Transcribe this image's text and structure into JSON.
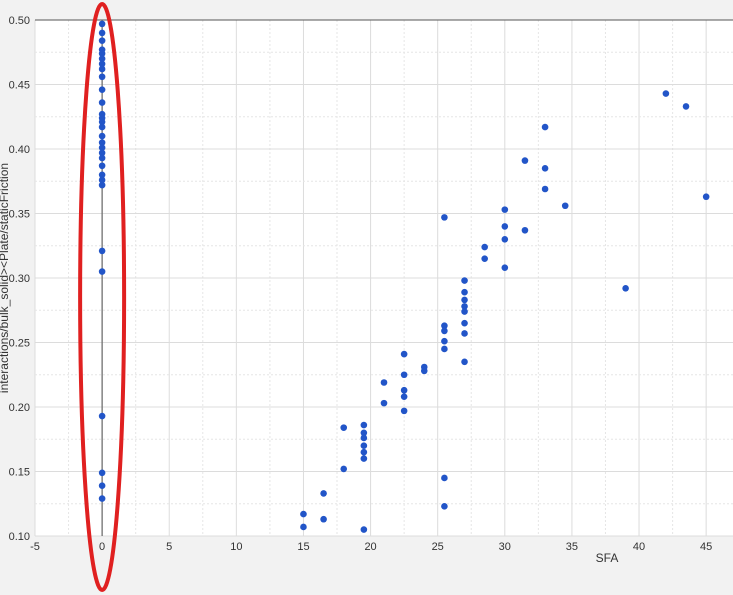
{
  "chart_data": {
    "type": "scatter",
    "xlabel": "SFA",
    "ylabel": "interactions/bulk_solid><Plate/staticFriction",
    "xlim": [
      -5,
      47
    ],
    "ylim": [
      0.1,
      0.5
    ],
    "x_ticks": [
      -5,
      0,
      5,
      10,
      15,
      20,
      25,
      30,
      35,
      40,
      45
    ],
    "y_ticks": [
      0.1,
      0.15,
      0.2,
      0.25,
      0.3,
      0.35,
      0.4,
      0.45,
      0.5
    ],
    "grid": true,
    "marker_color": "#2255c8",
    "highlight_color": "#e02020",
    "highlight": {
      "shape": "ellipse",
      "around_x": 0,
      "y_range": [
        0.1,
        0.5
      ]
    },
    "series": [
      {
        "points": [
          [
            0,
            0.497
          ],
          [
            0,
            0.49
          ],
          [
            0,
            0.484
          ],
          [
            0,
            0.477
          ],
          [
            0,
            0.474
          ],
          [
            0,
            0.47
          ],
          [
            0,
            0.466
          ],
          [
            0,
            0.462
          ],
          [
            0,
            0.456
          ],
          [
            0,
            0.446
          ],
          [
            0,
            0.436
          ],
          [
            0,
            0.427
          ],
          [
            0,
            0.424
          ],
          [
            0,
            0.421
          ],
          [
            0,
            0.417
          ],
          [
            0,
            0.41
          ],
          [
            0,
            0.405
          ],
          [
            0,
            0.401
          ],
          [
            0,
            0.397
          ],
          [
            0,
            0.393
          ],
          [
            0,
            0.387
          ],
          [
            0,
            0.38
          ],
          [
            0,
            0.376
          ],
          [
            0,
            0.372
          ],
          [
            0,
            0.321
          ],
          [
            0,
            0.305
          ],
          [
            0,
            0.193
          ],
          [
            0,
            0.149
          ],
          [
            0,
            0.139
          ],
          [
            0,
            0.129
          ],
          [
            15,
            0.117
          ],
          [
            15,
            0.107
          ],
          [
            16.5,
            0.133
          ],
          [
            16.5,
            0.113
          ],
          [
            18,
            0.184
          ],
          [
            18,
            0.152
          ],
          [
            19.5,
            0.186
          ],
          [
            19.5,
            0.18
          ],
          [
            19.5,
            0.176
          ],
          [
            19.5,
            0.17
          ],
          [
            19.5,
            0.165
          ],
          [
            19.5,
            0.16
          ],
          [
            19.5,
            0.105
          ],
          [
            21,
            0.219
          ],
          [
            21,
            0.203
          ],
          [
            22.5,
            0.241
          ],
          [
            22.5,
            0.225
          ],
          [
            22.5,
            0.213
          ],
          [
            22.5,
            0.208
          ],
          [
            22.5,
            0.197
          ],
          [
            24,
            0.231
          ],
          [
            24,
            0.228
          ],
          [
            25.5,
            0.347
          ],
          [
            25.5,
            0.263
          ],
          [
            25.5,
            0.259
          ],
          [
            25.5,
            0.251
          ],
          [
            25.5,
            0.245
          ],
          [
            25.5,
            0.145
          ],
          [
            25.5,
            0.123
          ],
          [
            27,
            0.298
          ],
          [
            27,
            0.289
          ],
          [
            27,
            0.283
          ],
          [
            27,
            0.278
          ],
          [
            27,
            0.274
          ],
          [
            27,
            0.265
          ],
          [
            27,
            0.257
          ],
          [
            27,
            0.235
          ],
          [
            28.5,
            0.324
          ],
          [
            28.5,
            0.315
          ],
          [
            30,
            0.353
          ],
          [
            30,
            0.34
          ],
          [
            30,
            0.33
          ],
          [
            30,
            0.308
          ],
          [
            31.5,
            0.391
          ],
          [
            31.5,
            0.337
          ],
          [
            33,
            0.417
          ],
          [
            33,
            0.385
          ],
          [
            33,
            0.369
          ],
          [
            34.5,
            0.356
          ],
          [
            39,
            0.292
          ],
          [
            42,
            0.443
          ],
          [
            43.5,
            0.433
          ],
          [
            45,
            0.363
          ]
        ]
      }
    ]
  }
}
